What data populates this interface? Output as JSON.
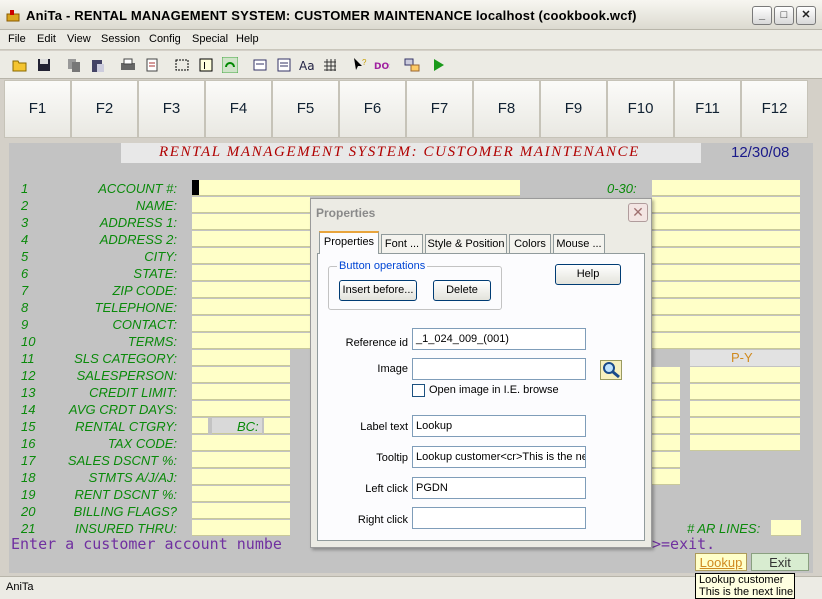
{
  "window": {
    "title": "AniTa - RENTAL MANAGEMENT SYSTEM: CUSTOMER MAINTENANCE  localhost (cookbook.wcf)",
    "minimize": "_",
    "maximize": "□",
    "close": "✕"
  },
  "menu": [
    "File",
    "Edit",
    "View",
    "Session",
    "Config",
    "Special",
    "Help"
  ],
  "toolbar_icons": [
    "open-folder-icon",
    "save-icon",
    "copy-icon",
    "paste-icon",
    "print-icon",
    "print-preview-icon",
    "select-icon",
    "label-icon",
    "refresh-icon",
    "form-icon",
    "list-icon",
    "font-icon",
    "grid-icon",
    "pointer-help-icon",
    "dos-icon",
    "connect-icon",
    "play-icon"
  ],
  "fkeys": [
    "F1",
    "F2",
    "F3",
    "F4",
    "F5",
    "F6",
    "F7",
    "F8",
    "F9",
    "F10",
    "F11",
    "F12"
  ],
  "screen": {
    "header_title": "RENTAL MANAGEMENT SYSTEM: CUSTOMER MAINTENANCE",
    "date": "12/30/08",
    "rows": [
      {
        "num": "1",
        "label": "ACCOUNT #:"
      },
      {
        "num": "2",
        "label": "NAME:"
      },
      {
        "num": "3",
        "label": "ADDRESS 1:"
      },
      {
        "num": "4",
        "label": "ADDRESS 2:"
      },
      {
        "num": "5",
        "label": "CITY:"
      },
      {
        "num": "6",
        "label": "STATE:"
      },
      {
        "num": "7",
        "label": "ZIP CODE:"
      },
      {
        "num": "8",
        "label": "TELEPHONE:"
      },
      {
        "num": "9",
        "label": "CONTACT:"
      },
      {
        "num": "10",
        "label": "TERMS:"
      },
      {
        "num": "11",
        "label": "SLS CATEGORY:"
      },
      {
        "num": "12",
        "label": "SALESPERSON:"
      },
      {
        "num": "13",
        "label": "CREDIT LIMIT:"
      },
      {
        "num": "14",
        "label": "AVG CRDT DAYS:"
      },
      {
        "num": "15",
        "label": "RENTAL CTGRY:"
      },
      {
        "num": "16",
        "label": "TAX CODE:"
      },
      {
        "num": "17",
        "label": "SALES DSCNT %:"
      },
      {
        "num": "18",
        "label": "STMTS  A/J/AJ:"
      },
      {
        "num": "19",
        "label": "RENT DSCNT %:"
      },
      {
        "num": "20",
        "label": "BILLING FLAGS?"
      },
      {
        "num": "21",
        "label": "INSURED THRU:"
      }
    ],
    "bc_label": "BC:",
    "aging_label": "0-30:",
    "py_label": "P-Y",
    "ar_lines_label": "# AR LINES:",
    "prompt": "Enter a customer account numbe",
    "prompt_tail": ">=exit.",
    "lookup_button": "Lookup",
    "exit_button": "Exit"
  },
  "dialog": {
    "title": "Properties",
    "close": "✕",
    "tabs": [
      "Properties",
      "Font ...",
      "Style & Position",
      "Colors",
      "Mouse ..."
    ],
    "group_label": "Button operations",
    "insert_before": "Insert before...",
    "delete": "Delete",
    "help": "Help",
    "reference_id_label": "Reference id",
    "reference_id_value": "_1_024_009_(001)",
    "image_label": "Image",
    "image_value": "",
    "open_image_label": "Open image in I.E. browse",
    "open_image_checked": false,
    "label_text_label": "Label text",
    "label_text_value": "Lookup",
    "tooltip_label": "Tooltip",
    "tooltip_value": "Lookup customer<cr>This is the ne",
    "left_click_label": "Left click",
    "left_click_value": "PGDN",
    "right_click_label": "Right click",
    "right_click_value": ""
  },
  "tooltip": {
    "line1": "Lookup customer",
    "line2": "This is the next line"
  },
  "status": {
    "text": "AniTa"
  }
}
